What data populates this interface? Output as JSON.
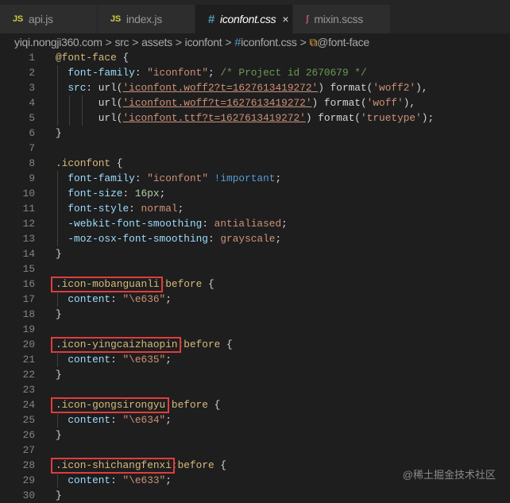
{
  "tabs": [
    {
      "icon": "JS",
      "label": "api.js",
      "active": false
    },
    {
      "icon": "JS",
      "label": "index.js",
      "active": false
    },
    {
      "icon": "#",
      "label": "iconfont.css",
      "active": true
    },
    {
      "icon": "sass",
      "label": "mixin.scss",
      "active": false
    }
  ],
  "tab_close": "×",
  "breadcrumb": [
    "yiqi.nongji360.com",
    "src",
    "assets",
    "iconfont",
    "iconfont.css",
    "@font-face"
  ],
  "breadcrumb_sep": ">",
  "breadcrumb_hash": "#",
  "code": [
    [
      [
        "@font-face",
        "sel"
      ],
      [
        " {",
        "p"
      ]
    ],
    [
      [
        "  font-family",
        "prop"
      ],
      [
        ": ",
        "p"
      ],
      [
        "\"iconfont\"",
        "str"
      ],
      [
        "; ",
        "p"
      ],
      [
        "/* Project id 2670679 */",
        "com"
      ]
    ],
    [
      [
        "  src",
        "prop"
      ],
      [
        ": ",
        "p"
      ],
      [
        "url(",
        "p"
      ],
      [
        "'iconfont.woff2?t=1627613419272'",
        "str u"
      ],
      [
        ") ",
        "p"
      ],
      [
        "format(",
        "p"
      ],
      [
        "'woff2'",
        "str"
      ],
      [
        "),",
        "p"
      ]
    ],
    [
      [
        "       url(",
        "p"
      ],
      [
        "'iconfont.woff?t=1627613419272'",
        "str u"
      ],
      [
        ") ",
        "p"
      ],
      [
        "format(",
        "p"
      ],
      [
        "'woff'",
        "str"
      ],
      [
        "),",
        "p"
      ]
    ],
    [
      [
        "       url(",
        "p"
      ],
      [
        "'iconfont.ttf?t=1627613419272'",
        "str u"
      ],
      [
        ") ",
        "p"
      ],
      [
        "format(",
        "p"
      ],
      [
        "'truetype'",
        "str"
      ],
      [
        ");",
        "p"
      ]
    ],
    [
      [
        "}",
        "p"
      ]
    ],
    [],
    [
      [
        ".iconfont",
        "sel"
      ],
      [
        " {",
        "p"
      ]
    ],
    [
      [
        "  font-family",
        "prop"
      ],
      [
        ": ",
        "p"
      ],
      [
        "\"iconfont\"",
        "str"
      ],
      [
        " !important",
        "kw"
      ],
      [
        ";",
        "p"
      ]
    ],
    [
      [
        "  font-size",
        "prop"
      ],
      [
        ": ",
        "p"
      ],
      [
        "16px",
        "num"
      ],
      [
        ";",
        "p"
      ]
    ],
    [
      [
        "  font-style",
        "prop"
      ],
      [
        ": ",
        "p"
      ],
      [
        "normal",
        "str"
      ],
      [
        ";",
        "p"
      ]
    ],
    [
      [
        "  -webkit-font-smoothing",
        "prop"
      ],
      [
        ": ",
        "p"
      ],
      [
        "antialiased",
        "str"
      ],
      [
        ";",
        "p"
      ]
    ],
    [
      [
        "  -moz-osx-font-smoothing",
        "prop"
      ],
      [
        ": ",
        "p"
      ],
      [
        "grayscale",
        "str"
      ],
      [
        ";",
        "p"
      ]
    ],
    [
      [
        "}",
        "p"
      ]
    ],
    [],
    [
      [
        ".icon-mobanguanli",
        "sel"
      ],
      [
        ":before",
        "sel"
      ],
      [
        " {",
        "p"
      ]
    ],
    [
      [
        "  content",
        "prop"
      ],
      [
        ": ",
        "p"
      ],
      [
        "\"\\e636\"",
        "str"
      ],
      [
        ";",
        "p"
      ]
    ],
    [
      [
        "}",
        "p"
      ]
    ],
    [],
    [
      [
        ".icon-yingcaizhaopin",
        "sel"
      ],
      [
        ":before",
        "sel"
      ],
      [
        " {",
        "p"
      ]
    ],
    [
      [
        "  content",
        "prop"
      ],
      [
        ": ",
        "p"
      ],
      [
        "\"\\e635\"",
        "str"
      ],
      [
        ";",
        "p"
      ]
    ],
    [
      [
        "}",
        "p"
      ]
    ],
    [],
    [
      [
        ".icon-gongsirongyu",
        "sel"
      ],
      [
        ":before",
        "sel"
      ],
      [
        " {",
        "p"
      ]
    ],
    [
      [
        "  content",
        "prop"
      ],
      [
        ": ",
        "p"
      ],
      [
        "\"\\e634\"",
        "str"
      ],
      [
        ";",
        "p"
      ]
    ],
    [
      [
        "}",
        "p"
      ]
    ],
    [],
    [
      [
        ".icon-shichangfenxi",
        "sel"
      ],
      [
        ":before",
        "sel"
      ],
      [
        " {",
        "p"
      ]
    ],
    [
      [
        "  content",
        "prop"
      ],
      [
        ": ",
        "p"
      ],
      [
        "\"\\e633\"",
        "str"
      ],
      [
        ";",
        "p"
      ]
    ],
    [
      [
        "}",
        "p"
      ]
    ]
  ],
  "highlight_lines": [
    16,
    20,
    24,
    28
  ],
  "highlight_color": "#e03c3c",
  "watermark": "@稀土掘金技术社区"
}
